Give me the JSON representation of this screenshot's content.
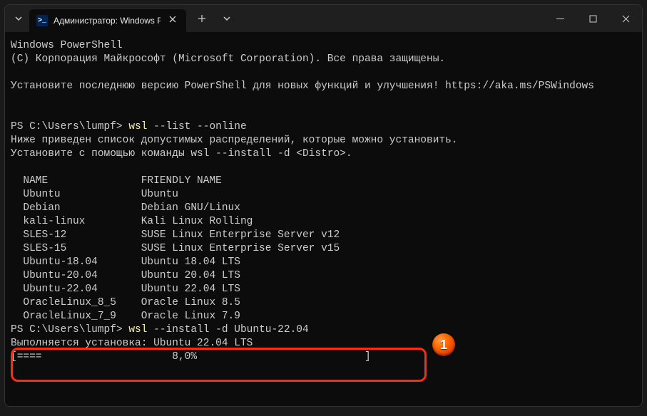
{
  "titlebar": {
    "tab_title": "Администратор: Windows Po",
    "tab_icon_text": ">_"
  },
  "terminal": {
    "header_line1": "Windows PowerShell",
    "header_line2": "(C) Корпорация Майкрософт (Microsoft Corporation). Все права защищены.",
    "notice_prefix": "Установите последнюю версию PowerShell для новых функций и улучшения! ",
    "notice_link": "https://aka.ms/PSWindows",
    "prompt1_path": "PS C:\\Users\\lumpf> ",
    "prompt1_cmd": "wsl ",
    "prompt1_args": "--list --online",
    "list_intro1": "Ниже приведен список допустимых распределений, которые можно установить.",
    "list_intro2": "Установите с помощью команды wsl --install -d <Distro>.",
    "col_head": "  NAME               FRIENDLY NAME",
    "rows": [
      "  Ubuntu             Ubuntu",
      "  Debian             Debian GNU/Linux",
      "  kali-linux         Kali Linux Rolling",
      "  SLES-12            SUSE Linux Enterprise Server v12",
      "  SLES-15            SUSE Linux Enterprise Server v15",
      "  Ubuntu-18.04       Ubuntu 18.04 LTS",
      "  Ubuntu-20.04       Ubuntu 20.04 LTS",
      "  Ubuntu-22.04       Ubuntu 22.04 LTS",
      "  OracleLinux_8_5    Oracle Linux 8.5",
      "  OracleLinux_7_9    Oracle Linux 7.9"
    ],
    "prompt2_path": "PS C:\\Users\\lumpf> ",
    "prompt2_cmd": "wsl ",
    "prompt2_args": "--install -d ",
    "prompt2_target": "Ubuntu-22.04",
    "install_line": "Выполняется установка: Ubuntu 22.04 LTS",
    "progress_line": "[====                     8,0%                           ]"
  },
  "callout": {
    "n": "1"
  }
}
